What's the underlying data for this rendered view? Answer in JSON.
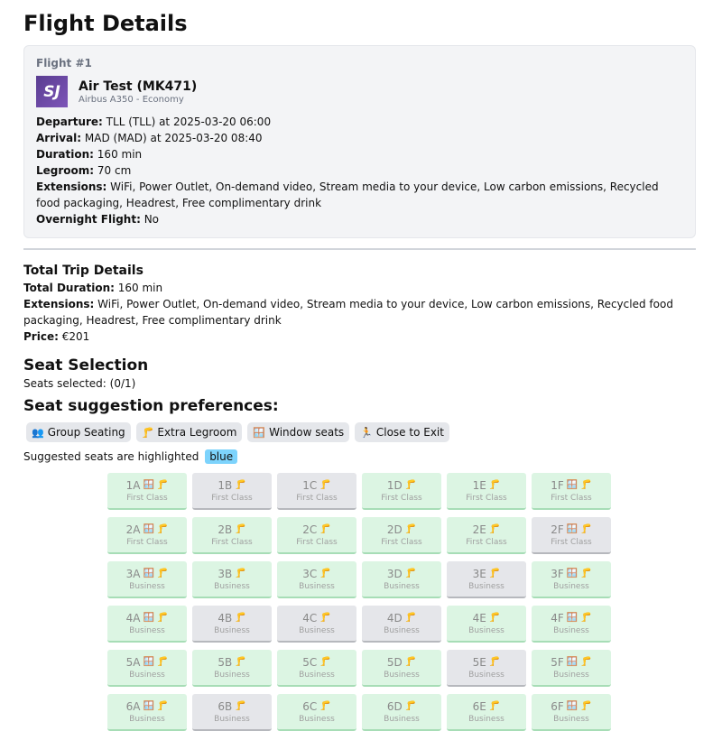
{
  "page": {
    "title": "Flight Details"
  },
  "flight": {
    "number_label": "Flight #1",
    "logo_text": "SJ",
    "airline": "Air Test (MK471)",
    "aircraft": "Airbus A350 - Economy",
    "rows": [
      {
        "label": "Departure:",
        "value": "TLL (TLL) at 2025-03-20 06:00"
      },
      {
        "label": "Arrival:",
        "value": "MAD (MAD) at 2025-03-20 08:40"
      },
      {
        "label": "Duration:",
        "value": "160 min"
      },
      {
        "label": "Legroom:",
        "value": "70 cm"
      },
      {
        "label": "Extensions:",
        "value": "WiFi, Power Outlet, On-demand video, Stream media to your device, Low carbon emissions, Recycled food packaging, Headrest, Free complimentary drink"
      },
      {
        "label": "Overnight Flight:",
        "value": "No"
      }
    ]
  },
  "trip": {
    "title": "Total Trip Details",
    "rows": [
      {
        "label": "Total Duration:",
        "value": "160 min"
      },
      {
        "label": "Extensions:",
        "value": "WiFi, Power Outlet, On-demand video, Stream media to your device, Low carbon emissions, Recycled food packaging, Headrest, Free complimentary drink"
      },
      {
        "label": "Price:",
        "value": "€201"
      }
    ]
  },
  "seat_selection": {
    "title": "Seat Selection",
    "selected_text": "Seats selected: (0/1)",
    "prefs_title": "Seat suggestion preferences:",
    "prefs": [
      {
        "icon": "group-icon",
        "glyph": "👥",
        "label": "Group Seating"
      },
      {
        "icon": "legroom-icon",
        "glyph": "🦵",
        "label": "Extra Legroom"
      },
      {
        "icon": "window-icon",
        "glyph": "🪟",
        "label": "Window seats"
      },
      {
        "icon": "exit-icon",
        "glyph": "🏃",
        "label": "Close to Exit"
      }
    ],
    "hint_text": "Suggested seats are highlighted",
    "hint_badge": "blue"
  },
  "seats": [
    [
      {
        "label": "1A",
        "window": true,
        "legroom": true,
        "cls": "First Class",
        "suggested": true
      },
      {
        "label": "1B",
        "window": false,
        "legroom": true,
        "cls": "First Class",
        "suggested": false
      },
      {
        "label": "1C",
        "window": false,
        "legroom": true,
        "cls": "First Class",
        "suggested": false
      },
      {
        "label": "1D",
        "window": false,
        "legroom": true,
        "cls": "First Class",
        "suggested": true
      },
      {
        "label": "1E",
        "window": false,
        "legroom": true,
        "cls": "First Class",
        "suggested": true
      },
      {
        "label": "1F",
        "window": true,
        "legroom": true,
        "cls": "First Class",
        "suggested": true
      }
    ],
    [
      {
        "label": "2A",
        "window": true,
        "legroom": true,
        "cls": "First Class",
        "suggested": true
      },
      {
        "label": "2B",
        "window": false,
        "legroom": true,
        "cls": "First Class",
        "suggested": true
      },
      {
        "label": "2C",
        "window": false,
        "legroom": true,
        "cls": "First Class",
        "suggested": true
      },
      {
        "label": "2D",
        "window": false,
        "legroom": true,
        "cls": "First Class",
        "suggested": true
      },
      {
        "label": "2E",
        "window": false,
        "legroom": true,
        "cls": "First Class",
        "suggested": true
      },
      {
        "label": "2F",
        "window": true,
        "legroom": true,
        "cls": "First Class",
        "suggested": false
      }
    ],
    [
      {
        "label": "3A",
        "window": true,
        "legroom": true,
        "cls": "Business",
        "suggested": true
      },
      {
        "label": "3B",
        "window": false,
        "legroom": true,
        "cls": "Business",
        "suggested": true
      },
      {
        "label": "3C",
        "window": false,
        "legroom": true,
        "cls": "Business",
        "suggested": true
      },
      {
        "label": "3D",
        "window": false,
        "legroom": true,
        "cls": "Business",
        "suggested": true
      },
      {
        "label": "3E",
        "window": false,
        "legroom": true,
        "cls": "Business",
        "suggested": false
      },
      {
        "label": "3F",
        "window": true,
        "legroom": true,
        "cls": "Business",
        "suggested": true
      }
    ],
    [
      {
        "label": "4A",
        "window": true,
        "legroom": true,
        "cls": "Business",
        "suggested": true
      },
      {
        "label": "4B",
        "window": false,
        "legroom": true,
        "cls": "Business",
        "suggested": false
      },
      {
        "label": "4C",
        "window": false,
        "legroom": true,
        "cls": "Business",
        "suggested": false
      },
      {
        "label": "4D",
        "window": false,
        "legroom": true,
        "cls": "Business",
        "suggested": false
      },
      {
        "label": "4E",
        "window": false,
        "legroom": true,
        "cls": "Business",
        "suggested": true
      },
      {
        "label": "4F",
        "window": true,
        "legroom": true,
        "cls": "Business",
        "suggested": true
      }
    ],
    [
      {
        "label": "5A",
        "window": true,
        "legroom": true,
        "cls": "Business",
        "suggested": true
      },
      {
        "label": "5B",
        "window": false,
        "legroom": true,
        "cls": "Business",
        "suggested": true
      },
      {
        "label": "5C",
        "window": false,
        "legroom": true,
        "cls": "Business",
        "suggested": true
      },
      {
        "label": "5D",
        "window": false,
        "legroom": true,
        "cls": "Business",
        "suggested": true
      },
      {
        "label": "5E",
        "window": false,
        "legroom": true,
        "cls": "Business",
        "suggested": false
      },
      {
        "label": "5F",
        "window": true,
        "legroom": true,
        "cls": "Business",
        "suggested": true
      }
    ],
    [
      {
        "label": "6A",
        "window": true,
        "legroom": true,
        "cls": "Business",
        "suggested": true
      },
      {
        "label": "6B",
        "window": false,
        "legroom": true,
        "cls": "Business",
        "suggested": false
      },
      {
        "label": "6C",
        "window": false,
        "legroom": true,
        "cls": "Business",
        "suggested": true
      },
      {
        "label": "6D",
        "window": false,
        "legroom": true,
        "cls": "Business",
        "suggested": true
      },
      {
        "label": "6E",
        "window": false,
        "legroom": true,
        "cls": "Business",
        "suggested": true
      },
      {
        "label": "6F",
        "window": true,
        "legroom": true,
        "cls": "Business",
        "suggested": true
      }
    ]
  ],
  "colors": {
    "suggested_bg": "#dcf5e3",
    "taken_bg": "#e5e6ea",
    "logo_bg": "#6b4fa0",
    "badge_bg": "#7dd3fc"
  }
}
